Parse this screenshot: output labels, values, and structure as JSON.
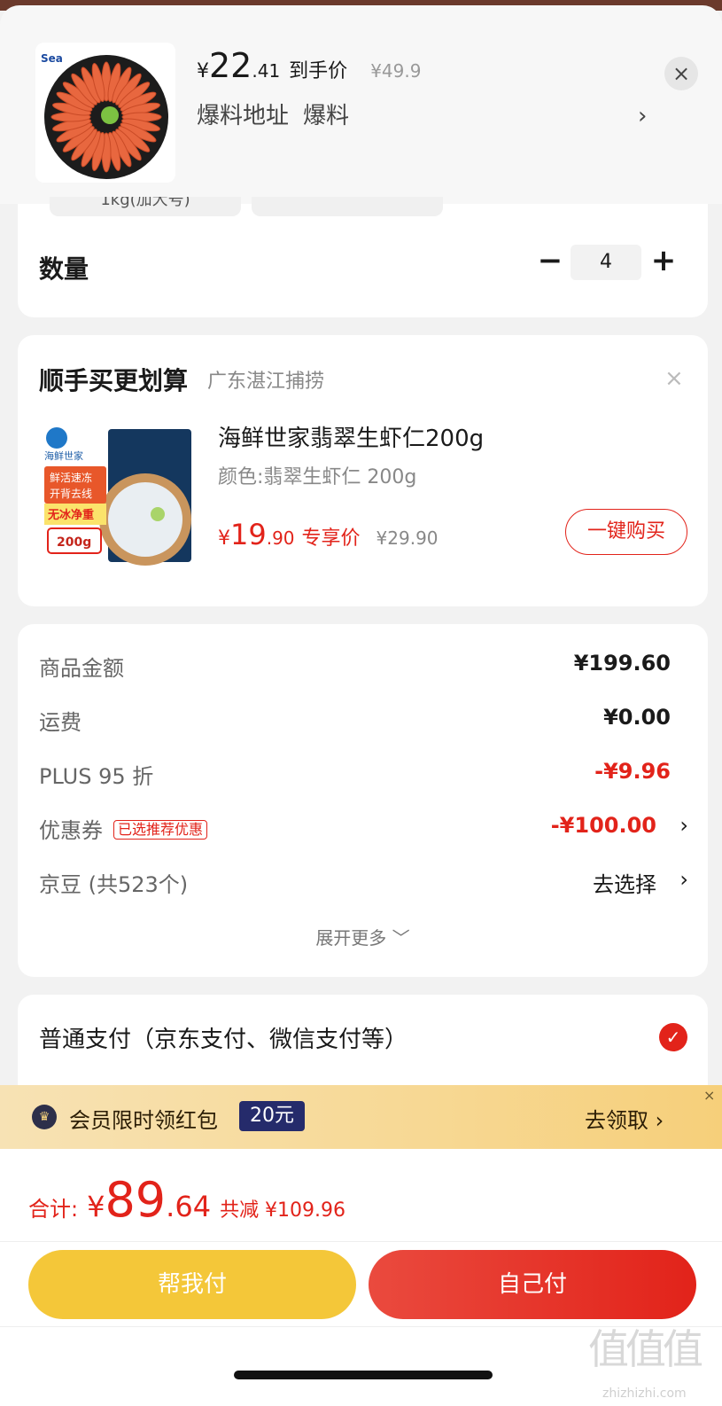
{
  "header": {
    "price_yen": "¥",
    "price_int": "22",
    "price_dec": ".41",
    "price_label": "到手价",
    "orig_price": "¥49.9",
    "tip_left": "爆料地址",
    "tip_right": "爆料",
    "tip_arrow": "›",
    "close": "×",
    "chips": [
      "1kg(加大号)",
      ""
    ]
  },
  "quantity": {
    "label": "数量",
    "minus": "−",
    "value": "4",
    "plus": "+"
  },
  "recommend": {
    "title": "顺手买更划算",
    "subtitle": "广东湛江捕捞",
    "close": "×",
    "product_name": "海鲜世家翡翠生虾仁200g",
    "spec": "颜色:翡翠生虾仁 200g",
    "price_yen": "¥",
    "price_int": "19",
    "price_dec": ".90",
    "price_label": "专享价",
    "orig_price": "¥29.90",
    "buy_label": "一键购买",
    "image_texts": [
      "海鲜世家",
      "鲜活速冻",
      "开背去线",
      "无冰净重",
      "200g"
    ]
  },
  "summary": {
    "rows": [
      {
        "label": "商品金额",
        "value": "¥199.60"
      },
      {
        "label": "运费",
        "value": "¥0.00"
      },
      {
        "label": "PLUS 95 折",
        "value": "-¥9.96"
      },
      {
        "label": "优惠券",
        "badge": "已选推荐优惠",
        "value": "-¥100.00",
        "arrow": "›"
      },
      {
        "label": "京豆 (共523个)",
        "value": "去选择",
        "arrow": "›"
      }
    ],
    "expand": "展开更多 ﹀"
  },
  "payment": {
    "label": "普通支付（京东支付、微信支付等）",
    "check": "✓"
  },
  "banner": {
    "text": "会员限时领红包",
    "badge": "20元",
    "cta": "去领取 ›",
    "close": "×"
  },
  "footer": {
    "total_label": "合计:",
    "total_yen": "¥",
    "total_int": "89",
    "total_dec": ".64",
    "saved": "共减 ¥109.96",
    "help_pay": "帮我付",
    "self_pay": "自己付"
  },
  "watermark": {
    "main": "值值值",
    "sub": "zhizhizhi.com"
  },
  "colors": {
    "accent_red": "#e2231a",
    "gold": "#f4c739",
    "banner_navy": "#252b6b"
  },
  "icons": [
    "close-icon",
    "minus-icon",
    "plus-icon",
    "chevron-right-icon",
    "check-circle-icon",
    "crown-icon",
    "chevron-down-icon"
  ]
}
